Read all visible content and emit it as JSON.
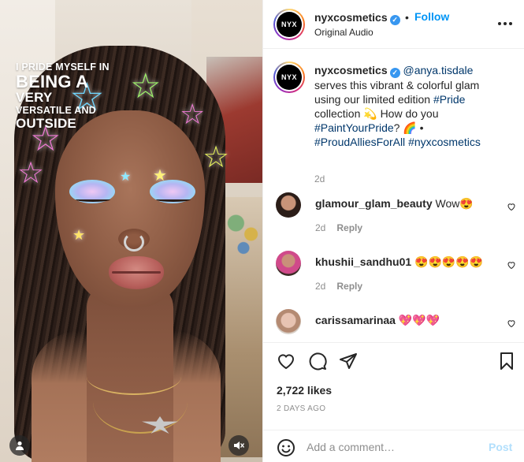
{
  "media": {
    "overlay_lines": [
      "I PRIDE MYSELF IN",
      "BEING A",
      "VERY",
      "VERSATILE AND",
      "OUTSIDE"
    ],
    "user_icon": "person-icon",
    "mute_icon": "speaker-muted-icon"
  },
  "header": {
    "username": "nyxcosmetics",
    "verified_mark": "✓",
    "separator": "•",
    "follow_label": "Follow",
    "subtitle": "Original Audio",
    "avatar_text": "NYX",
    "more_icon": "more-options-icon"
  },
  "caption": {
    "username": "nyxcosmetics",
    "mention": "@anya.tisdale",
    "text_1": " serves this vibrant & colorful glam using our limited edition ",
    "hashtag_pride": "#Pride",
    "text_2": " collection 💫 How do you ",
    "hashtag_paint": "#PaintYourPride",
    "text_3": "? 🌈 • ",
    "hashtag_allies": "#ProudAlliesForAll",
    "hashtag_nyx": "#nyxcosmetics",
    "time": "2d"
  },
  "comments": [
    {
      "username": "glamour_glam_beauty",
      "text": "Wow😍",
      "time": "2d",
      "reply_label": "Reply"
    },
    {
      "username": "khushii_sandhu01",
      "text": "😍😍😍😍😍",
      "time": "2d",
      "reply_label": "Reply"
    },
    {
      "username": "carissamarinaa",
      "text": "💖💖💖"
    }
  ],
  "actions": {
    "likes": "2,722 likes",
    "date": "2 DAYS AGO"
  },
  "add_comment": {
    "placeholder": "Add a comment…",
    "post_label": "Post"
  },
  "colors": {
    "link": "#00376b",
    "follow_blue": "#0095f6",
    "muted_text": "#8e8e8e",
    "post_disabled": "#b2dffc"
  }
}
